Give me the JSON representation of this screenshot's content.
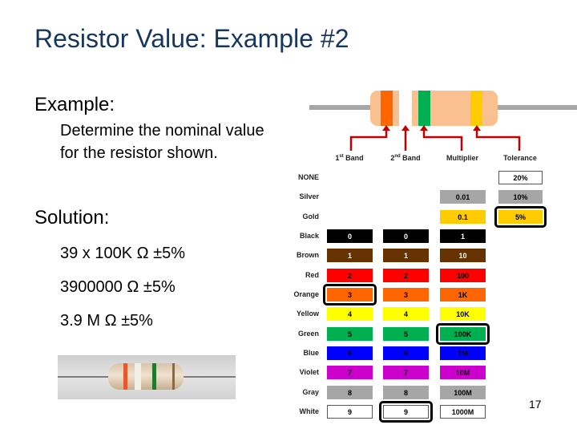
{
  "slide": {
    "title": "Resistor Value: Example #2",
    "example_heading": "Example:",
    "example_text": "Determine the nominal value for the resistor shown.",
    "solution_heading": "Solution:",
    "solution_lines": [
      "39 x 100K Ω  ±5%",
      "3900000 Ω  ±5%",
      "3.9 M Ω  ±5%"
    ],
    "page_number": "17"
  },
  "diagram": {
    "bands": [
      {
        "name": "1st Band",
        "sup": "st",
        "base": "1",
        "rest": " Band",
        "color": "#ff6600"
      },
      {
        "name": "2nd Band",
        "sup": "nd",
        "base": "2",
        "rest": " Band",
        "color": "#ffffff"
      },
      {
        "name": "Multiplier",
        "color": "#00b050"
      },
      {
        "name": "Tolerance",
        "color": "#ffcc00"
      }
    ],
    "headers": {
      "band1_base": "1",
      "band1_sup": "st",
      "band1_rest": " Band",
      "band2_base": "2",
      "band2_sup": "nd",
      "band2_rest": " Band",
      "multiplier": "Multiplier",
      "tolerance": "Tolerance"
    },
    "body_color": "#fac090",
    "lead_color": "#a6a6a6",
    "arrow_color": "#c00000"
  },
  "color_code_table": {
    "columns": [
      "1st Band",
      "2nd Band",
      "Multiplier",
      "Tolerance"
    ],
    "rows": [
      {
        "label": "NONE",
        "bg": "#ffffff",
        "fg": "#000000",
        "band1": null,
        "band2": null,
        "multiplier": null,
        "tolerance": "20%"
      },
      {
        "label": "Silver",
        "bg": "#a6a6a6",
        "fg": "#000000",
        "band1": null,
        "band2": null,
        "multiplier": "0.01",
        "tolerance": "10%"
      },
      {
        "label": "Gold",
        "bg": "#ffcc00",
        "fg": "#000000",
        "band1": null,
        "band2": null,
        "multiplier": "0.1",
        "tolerance": "5%"
      },
      {
        "label": "Black",
        "bg": "#000000",
        "fg": "#ffffff",
        "band1": "0",
        "band2": "0",
        "multiplier": "1",
        "tolerance": null
      },
      {
        "label": "Brown",
        "bg": "#663300",
        "fg": "#ffffff",
        "band1": "1",
        "band2": "1",
        "multiplier": "10",
        "tolerance": null
      },
      {
        "label": "Red",
        "bg": "#ff0000",
        "fg": "#000000",
        "band1": "2",
        "band2": "2",
        "multiplier": "100",
        "tolerance": null
      },
      {
        "label": "Orange",
        "bg": "#ff6600",
        "fg": "#000000",
        "band1": "3",
        "band2": "3",
        "multiplier": "1K",
        "tolerance": null
      },
      {
        "label": "Yellow",
        "bg": "#ffff00",
        "fg": "#000000",
        "band1": "4",
        "band2": "4",
        "multiplier": "10K",
        "tolerance": null
      },
      {
        "label": "Green",
        "bg": "#00b050",
        "fg": "#000000",
        "band1": "5",
        "band2": "5",
        "multiplier": "100K",
        "tolerance": null
      },
      {
        "label": "Blue",
        "bg": "#0000ff",
        "fg": "#000000",
        "band1": "6",
        "band2": "6",
        "multiplier": "1M",
        "tolerance": null
      },
      {
        "label": "Violet",
        "bg": "#cc00cc",
        "fg": "#000000",
        "band1": "7",
        "band2": "7",
        "multiplier": "10M",
        "tolerance": null
      },
      {
        "label": "Gray",
        "bg": "#a6a6a6",
        "fg": "#000000",
        "band1": "8",
        "band2": "8",
        "multiplier": "100M",
        "tolerance": null
      },
      {
        "label": "White",
        "bg": "#ffffff",
        "fg": "#000000",
        "band1": "9",
        "band2": "9",
        "multiplier": "1000M",
        "tolerance": null
      }
    ],
    "highlighted": [
      {
        "row": "Orange",
        "column": "1st Band"
      },
      {
        "row": "White",
        "column": "2nd Band"
      },
      {
        "row": "Green",
        "column": "Multiplier"
      },
      {
        "row": "Gold",
        "column": "Tolerance"
      }
    ]
  },
  "photo": {
    "description": "photo of resistor with orange, white, green, gold bands",
    "band_colors": [
      "#e8582a",
      "#f2efe8",
      "#1f7a2e",
      "#8a6a3a"
    ]
  }
}
